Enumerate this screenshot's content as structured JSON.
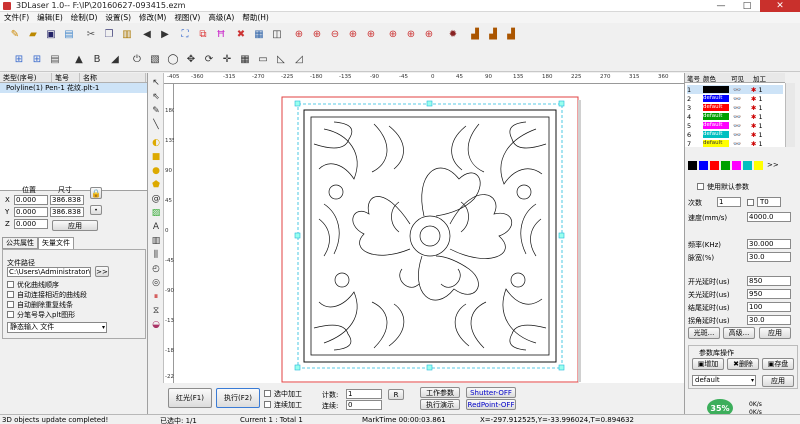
{
  "window": {
    "title": "3DLaser 1.0-- F:\\IP\\20160627-093415.ezm",
    "min": "—",
    "max": "□",
    "close": "✕"
  },
  "menu": [
    "文件(F)",
    "编辑(E)",
    "绘制(D)",
    "设置(S)",
    "修改(M)",
    "视图(V)",
    "高级(A)",
    "帮助(H)"
  ],
  "object_list": {
    "headers": [
      "类型(序号)",
      "笔号",
      "名称"
    ],
    "row": "Polyline(1) Pen-1 花纹.plt-1"
  },
  "position": {
    "pos_label": "位置",
    "size_label": "尺寸",
    "x_label": "X",
    "y_label": "Y",
    "z_label": "Z",
    "x": "0.000",
    "y": "0.000",
    "z": "0.000",
    "w": "386.838",
    "h": "386.838",
    "apply": "应用"
  },
  "tabs": {
    "common": "公共属性",
    "vector": "矢量文件"
  },
  "vector": {
    "path_label": "文件路径",
    "path": "C:\\Users\\Administrator\\D",
    "browse": ">>",
    "opt1": "优化曲线顺序",
    "opt2": "自动连接相近的曲线段",
    "opt3": "自动删除重复线条",
    "opt4": "分笔号导入plt图形",
    "mode": "静态输入 文件"
  },
  "ruler": {
    "h": [
      "-405",
      "-360",
      "-315",
      "-270",
      "-225",
      "-180",
      "-135",
      "-90",
      "-45",
      "0",
      "45",
      "90",
      "135",
      "180",
      "225",
      "270",
      "315",
      "360"
    ],
    "v": [
      "180",
      "135",
      "90",
      "45",
      "0",
      "-45",
      "-90",
      "-135",
      "-180",
      "-225"
    ]
  },
  "bottom": {
    "red_btn": "红光(F1)",
    "exec_btn": "执行(F2)",
    "cb1": "选中加工",
    "cb2": "连续加工",
    "count_label": "计数:",
    "count_val": "1",
    "cont_label": "连续:",
    "cont_val": "0",
    "r_btn": "R",
    "work_param": "工作参数",
    "exec_demo": "执行演示",
    "shutter": "Shutter-OFF",
    "redpoint": "RedPoint-OFF"
  },
  "pens": {
    "headers": [
      "笔号",
      "颜色",
      "可见",
      "加工"
    ],
    "rows": [
      {
        "no": "1",
        "color": "#000000",
        "name": "",
        "selected": true
      },
      {
        "no": "2",
        "color": "#0000ff",
        "name": "default"
      },
      {
        "no": "3",
        "color": "#ff0000",
        "name": "default"
      },
      {
        "no": "4",
        "color": "#00a000",
        "name": "default"
      },
      {
        "no": "5",
        "color": "#ff00ff",
        "name": "default"
      },
      {
        "no": "6",
        "color": "#00c0c0",
        "name": "default"
      },
      {
        "no": "7",
        "color": "#ffff00",
        "name": "default"
      }
    ],
    "one": "1",
    "palette": [
      "#000000",
      "#0000ff",
      "#ff0000",
      "#00a000",
      "#ff00ff",
      "#00c0c0",
      "#ffff00"
    ],
    "more": ">>"
  },
  "params": {
    "use_default": "使用默认参数",
    "count_label": "次数",
    "count": "1",
    "to_label": "T0",
    "speed_label": "速度(mm/s)",
    "speed": "4000.0",
    "freq_label": "频率(KHz)",
    "freq": "30.000",
    "duty_label": "脉宽(%)",
    "duty": "30.0",
    "on_label": "开光延时(us)",
    "on": "850",
    "off_label": "关光延时(us)",
    "off": "950",
    "end_label": "结尾延时(us)",
    "end": "100",
    "turn_label": "拐角延时(us)",
    "turn": "30.0",
    "light": "光斑...",
    "adv": "高级...",
    "apply": "应用",
    "lib_label": "参数库操作",
    "add": "增加",
    "del": "删除",
    "save": "存盘",
    "lib_val": "default",
    "lib_apply": "应用"
  },
  "gauge": {
    "pct": "35%",
    "up": "0K/s",
    "down": "0K/s"
  },
  "status": {
    "msg": "3D objects update completed!",
    "sel": "已选中: 1/1",
    "cur": "Current 1 : Total 1",
    "mark": "MarkTime 00:00:03.861",
    "coord": "X=-297.912525,Y=-33.996024,T=0.894632"
  }
}
